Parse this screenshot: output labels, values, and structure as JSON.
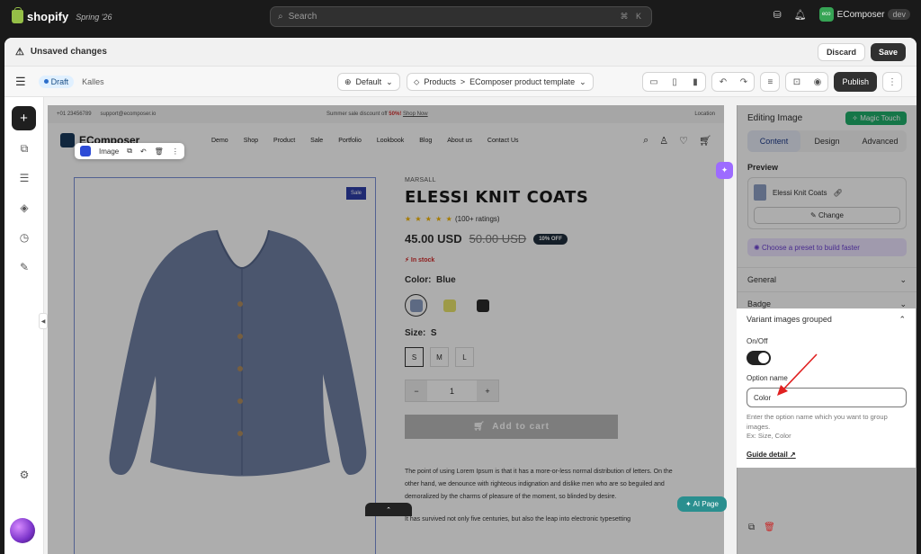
{
  "topbar": {
    "brand": "shopify",
    "edition": "Spring '26",
    "search_placeholder": "Search",
    "shortcut": "⌘ K",
    "store_initials": "eco",
    "store_name": "EComposer",
    "store_tag": "dev"
  },
  "unsaved": {
    "title": "Unsaved changes",
    "discard": "Discard",
    "save": "Save"
  },
  "toolbar": {
    "draft": "Draft",
    "theme": "Kalles",
    "device_select": "Default",
    "breadcrumb_parent": "Products",
    "breadcrumb_sep": ">",
    "breadcrumb_current": "EComposer product template",
    "publish": "Publish"
  },
  "store": {
    "phone": "+01 23456789",
    "email": "support@ecomposer.io",
    "announcement": "Summer sale discount off",
    "announcement_pct": "50%!",
    "announcement_cta": "Shop Now",
    "location": "Location",
    "brand": "EComposer",
    "nav": [
      "Demo",
      "Shop",
      "Product",
      "Sale",
      "Portfolio",
      "Lookbook",
      "Blog",
      "About us",
      "Contact Us"
    ],
    "image_tool": "Image",
    "sale_badge": "Sale",
    "vendor": "MARSALL",
    "title": "ELESSI KNIT COATS",
    "stars": "★ ★ ★ ★ ★",
    "ratings": "(100+ ratings)",
    "price": "45.00 USD",
    "compare_price": "50.00 USD",
    "discount": "10% OFF",
    "stock": "In stock",
    "color_label": "Color:",
    "color_value": "Blue",
    "size_label": "Size:",
    "size_value": "S",
    "sizes": [
      "S",
      "M",
      "L"
    ],
    "qty_minus": "−",
    "qty": "1",
    "qty_plus": "+",
    "add_to_cart": "Add to cart",
    "description": "The point of using Lorem Ipsum is that it has a more-or-less normal distribution of letters. On the other hand, we denounce with righteous indignation and dislike men who are so beguiled and demoralized by the charms of pleasure of the moment, so blinded by desire.",
    "description2": "It has survived not only five centuries, but also the leap into electronic typesetting"
  },
  "swatch_colors": [
    "#8a9cc2",
    "#e8e46a",
    "#2a2a2a"
  ],
  "ai_page": "AI Page",
  "panel": {
    "title": "Editing Image",
    "magic": "Magic Touch",
    "tabs": [
      "Content",
      "Design",
      "Advanced"
    ],
    "preview_label": "Preview",
    "preview_name": "Elessi Knit Coats",
    "change": "Change",
    "preset": "Choose a preset to build faster",
    "sections": [
      "General",
      "Badge"
    ],
    "variant": {
      "title": "Variant images grouped",
      "onoff": "On/Off",
      "option_label": "Option name",
      "option_value": "Color",
      "help": "Enter the option name which you want to group images.",
      "help2": "Ex: Size, Color",
      "guide": "Guide detail"
    }
  }
}
